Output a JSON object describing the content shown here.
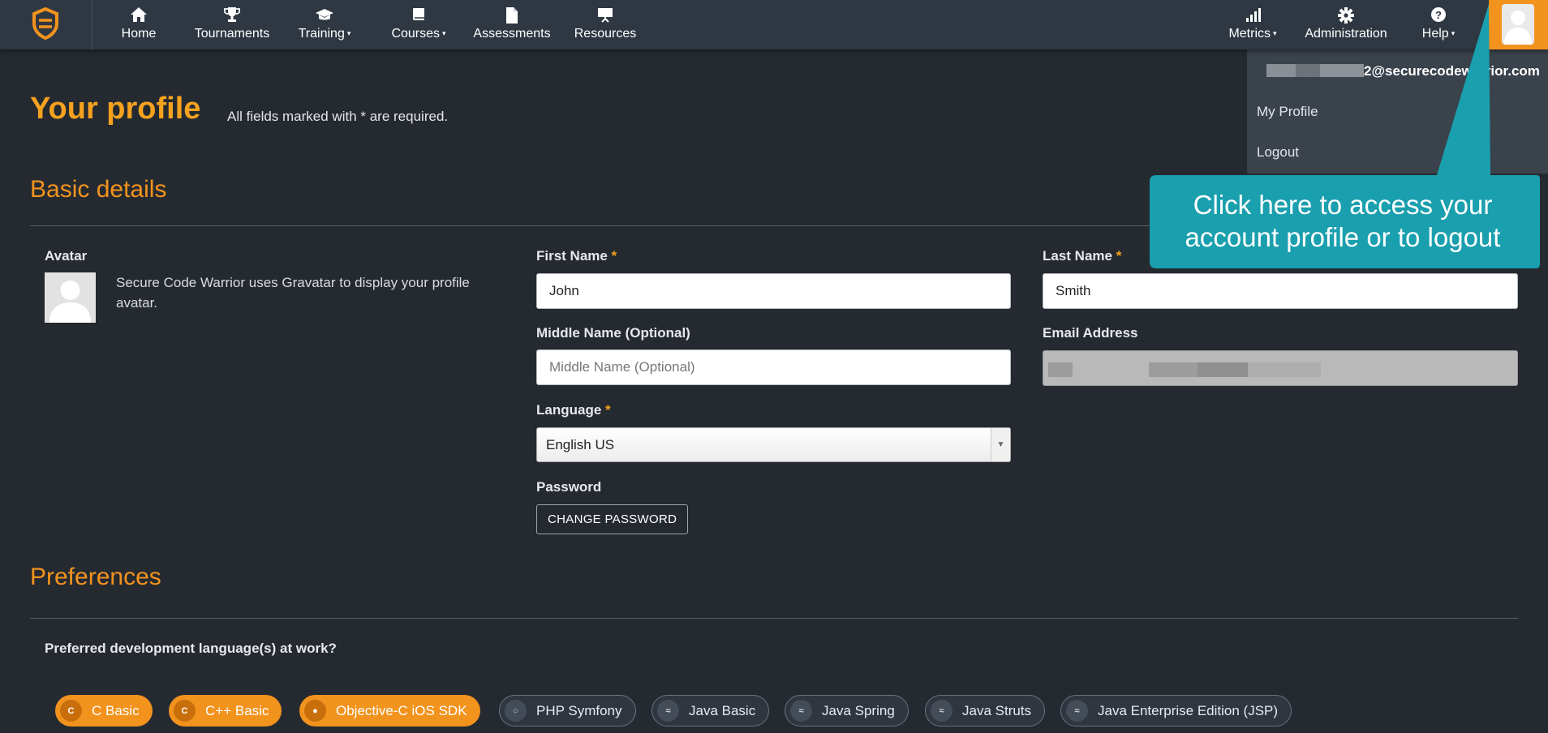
{
  "nav": {
    "items": [
      {
        "label": "Home",
        "icon": "home-icon"
      },
      {
        "label": "Tournaments",
        "icon": "trophy-icon"
      },
      {
        "label": "Training",
        "icon": "graduation-cap-icon",
        "caret": "▾"
      },
      {
        "label": "Courses",
        "icon": "book-icon",
        "caret": "▾"
      },
      {
        "label": "Assessments",
        "icon": "document-icon"
      },
      {
        "label": "Resources",
        "icon": "presentation-icon"
      }
    ],
    "right_items": [
      {
        "label": "Metrics",
        "icon": "bar-chart-icon",
        "caret": "▾"
      },
      {
        "label": "Administration",
        "icon": "gear-icon"
      },
      {
        "label": "Help",
        "icon": "question-circle-icon",
        "caret": "▾"
      }
    ],
    "accent": "#f2931e"
  },
  "page": {
    "title": "Your profile",
    "required_note": "All fields marked with * are required."
  },
  "basic": {
    "title": "Basic details",
    "avatar_label": "Avatar",
    "avatar_desc": "Secure Code Warrior uses Gravatar to display your profile avatar.",
    "first_name_label": "First Name",
    "first_name_value": "John",
    "last_name_label": "Last Name",
    "last_name_value": "Smith",
    "middle_name_label": "Middle Name (Optional)",
    "middle_name_placeholder": "Middle Name (Optional)",
    "email_label": "Email Address",
    "language_label": "Language",
    "language_value": "English US",
    "password_label": "Password",
    "change_password": "CHANGE PASSWORD",
    "required_star": "*"
  },
  "preferences": {
    "title": "Preferences",
    "question": "Preferred development language(s) at work?",
    "languages": [
      {
        "label": "C Basic",
        "selected": true,
        "icon": "c-lang-icon"
      },
      {
        "label": "C++ Basic",
        "selected": true,
        "icon": "cpp-lang-icon"
      },
      {
        "label": "Objective-C iOS SDK",
        "selected": true,
        "icon": "apple-icon"
      },
      {
        "label": "PHP Symfony",
        "selected": false,
        "icon": "php-icon"
      },
      {
        "label": "Java Basic",
        "selected": false,
        "icon": "java-icon"
      },
      {
        "label": "Java Spring",
        "selected": false,
        "icon": "java-icon"
      },
      {
        "label": "Java Struts",
        "selected": false,
        "icon": "java-icon"
      },
      {
        "label": "Java Enterprise Edition (JSP)",
        "selected": false,
        "icon": "java-icon"
      }
    ]
  },
  "user_menu": {
    "email_suffix": "2@securecodewarrior.com",
    "my_profile": "My Profile",
    "logout": "Logout"
  },
  "callout": {
    "line1": "Click here to access your",
    "line2": "account profile or to logout",
    "color": "#1a9fae"
  }
}
